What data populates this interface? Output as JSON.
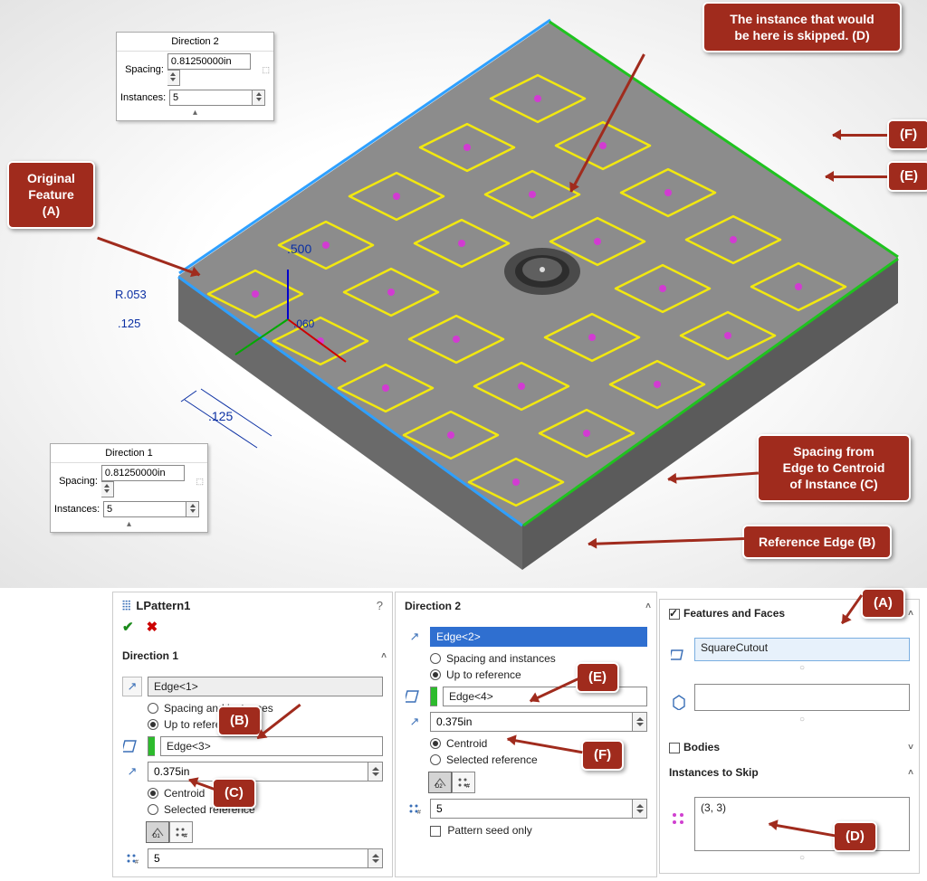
{
  "topCallouts": {
    "originalFeature": "Original\nFeature\n(A)",
    "skipped": "The instance that would\nbe here is skipped. (D)",
    "F": "(F)",
    "E": "(E)",
    "spacingC": "Spacing from\nEdge to Centroid\nof Instance (C)",
    "refEdgeB": "Reference Edge (B)"
  },
  "dimPanels": {
    "d2": {
      "title": "Direction 2",
      "spacingLabel": "Spacing:",
      "spacingValue": "0.81250000in",
      "instancesLabel": "Instances:",
      "instancesValue": "5"
    },
    "d1": {
      "title": "Direction 1",
      "spacingLabel": "Spacing:",
      "spacingValue": "0.81250000in",
      "instancesLabel": "Instances:",
      "instancesValue": "5"
    }
  },
  "annotations": {
    "dim500": ".500",
    "dimR053": "R.053",
    "dim125a": ".125",
    "dim125b": ".125",
    "dim060": ".060"
  },
  "pm": {
    "title": "LPattern1",
    "dir1": {
      "heading": "Direction 1",
      "edgeDir": "Edge<1>",
      "optSpacing": "Spacing and instances",
      "optUpTo": "Up to reference",
      "refEdge": "Edge<3>",
      "offset": "0.375in",
      "optCentroid": "Centroid",
      "optSelRef": "Selected reference",
      "count": "5"
    },
    "dir2": {
      "heading": "Direction 2",
      "edgeDir": "Edge<2>",
      "optSpacing": "Spacing and instances",
      "optUpTo": "Up to reference",
      "refEdge": "Edge<4>",
      "offset": "0.375in",
      "optCentroid": "Centroid",
      "optSelRef": "Selected reference",
      "count": "5",
      "patternSeed": "Pattern seed only"
    },
    "ff": {
      "heading": "Features and Faces",
      "feature": "SquareCutout"
    },
    "bodies": {
      "heading": "Bodies"
    },
    "skip": {
      "heading": "Instances to Skip",
      "value": "(3, 3)"
    },
    "tags": {
      "A": "(A)",
      "B": "(B)",
      "C": "(C)",
      "D": "(D)",
      "E": "(E)",
      "F": "(F)"
    }
  }
}
